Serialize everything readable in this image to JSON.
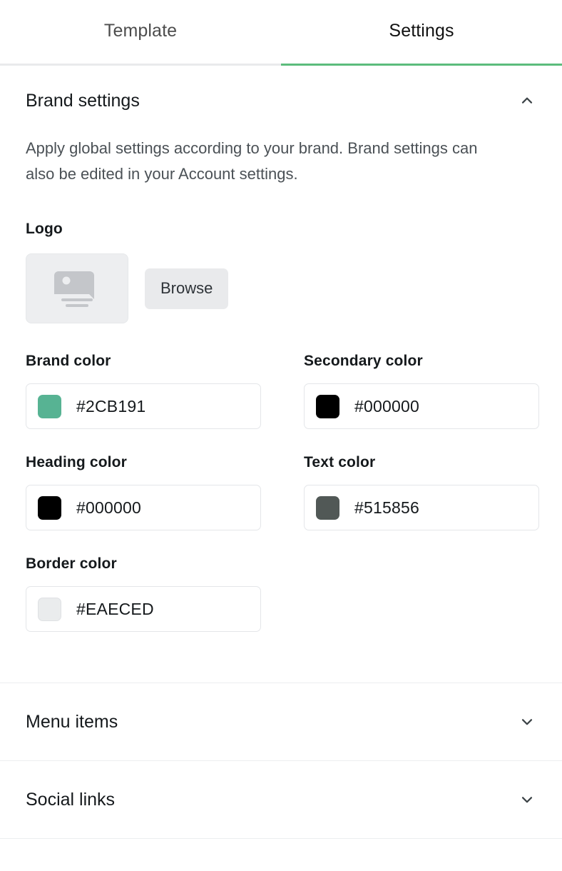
{
  "tabs": [
    {
      "label": "Template",
      "active": false
    },
    {
      "label": "Settings",
      "active": true
    }
  ],
  "brand_section": {
    "title": "Brand settings",
    "expanded": true,
    "toggle_icon": "chevron-up-icon",
    "description": "Apply global settings according to your brand. Brand settings can also be edited in your Account settings.",
    "logo": {
      "label": "Logo",
      "placeholder_icon": "image-placeholder-icon",
      "browse_label": "Browse"
    },
    "colors": [
      {
        "label": "Brand color",
        "value": "#2CB191",
        "swatch": "#57b393",
        "light": false
      },
      {
        "label": "Secondary color",
        "value": "#000000",
        "swatch": "#000000",
        "light": false
      },
      {
        "label": "Heading color",
        "value": "#000000",
        "swatch": "#000000",
        "light": false
      },
      {
        "label": "Text color",
        "value": "#515856",
        "swatch": "#515856",
        "light": false
      },
      {
        "label": "Border color",
        "value": "#EAECED",
        "swatch": "#eaeced",
        "light": true
      }
    ]
  },
  "other_sections": [
    {
      "title": "Menu items",
      "expanded": false,
      "toggle_icon": "chevron-down-icon"
    },
    {
      "title": "Social links",
      "expanded": false,
      "toggle_icon": "chevron-down-icon"
    }
  ],
  "accent": {
    "tab_underline": "#5CBC7C",
    "inactive_underline": "#E9EAEC"
  }
}
